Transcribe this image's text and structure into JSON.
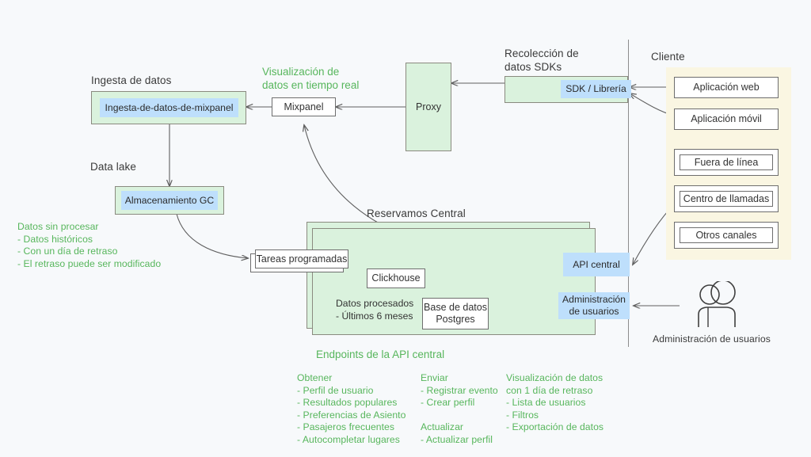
{
  "diagram": {
    "title_sections": {
      "ingesta": "Ingesta de datos",
      "data_lake": "Data lake",
      "realtime": "Visualización de\ndatos en tiempo real",
      "sdk_collection": "Recolección de\ndatos SDKs",
      "cliente": "Cliente",
      "reservamos": "Reservamos Central",
      "endpoints_title": "Endpoints de la API central",
      "user_admin_caption": "Administración de usuarios"
    },
    "nodes": {
      "ingesta_mixpanel": "Ingesta-de-datos-de-mixpanel",
      "mixpanel": "Mixpanel",
      "proxy": "Proxy",
      "sdk_libreria": "SDK / Librería",
      "almacenamiento_gc": "Almacenamiento GC",
      "tareas_programadas": "Tareas programadas",
      "clickhouse": "Clickhouse",
      "base_datos_postgres": "Base de datos\nPostgres",
      "datos_procesados": "Datos procesados\n-  Últimos 6 meses",
      "api_central": "API central",
      "administracion_usuarios": "Administración\nde usuarios"
    },
    "client_items": [
      {
        "label": "Aplicación web",
        "framed": false
      },
      {
        "label": "Aplicación móvil",
        "framed": false
      },
      {
        "label": "Fuera de línea",
        "framed": true
      },
      {
        "label": "Centro de llamadas",
        "framed": true
      },
      {
        "label": "Otros canales",
        "framed": true
      }
    ],
    "raw_data_note": {
      "heading": "Datos sin procesar",
      "items": [
        "-    Datos históricos",
        "-    Con un día de retraso",
        "-    El retraso puede ser modificado"
      ]
    },
    "endpoints": [
      {
        "heading": "Obtener",
        "items": [
          "- Perfil de usuario",
          "- Resultados populares",
          "- Preferencias de Asiento",
          "- Pasajeros frecuentes",
          "- Autocompletar lugares"
        ]
      },
      {
        "heading": "Enviar",
        "items": [
          "- Registrar evento",
          "- Crear perfil"
        ],
        "heading2": "Actualizar",
        "items2": [
          "- Actualizar perfil"
        ]
      },
      {
        "heading": "Visualización de datos\ncon 1 día de retraso",
        "items": [
          "- Lista de usuarios",
          "- Filtros",
          "- Exportación de datos"
        ]
      }
    ],
    "colors": {
      "background": "#f7f9fb",
      "green_fill": "#daf2dd",
      "blue_fill": "#bedffc",
      "cream_fill": "#faf6e2",
      "green_text": "#57b65c",
      "stroke": "#6e6e6e"
    }
  }
}
